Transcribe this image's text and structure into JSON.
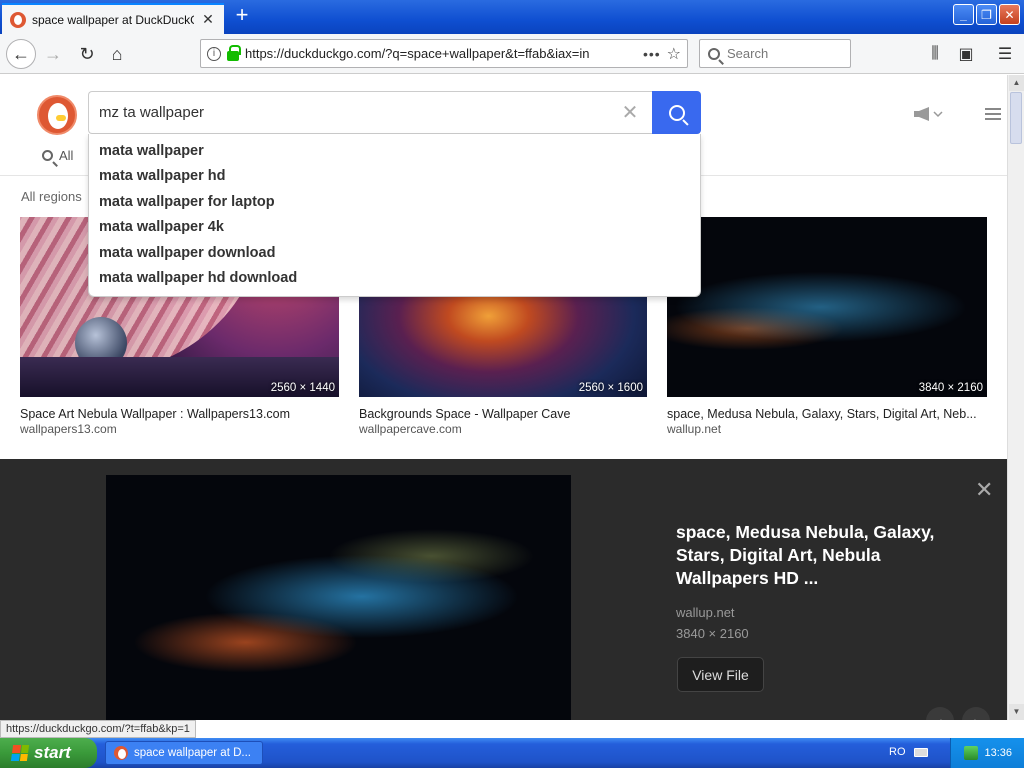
{
  "browser": {
    "tab_title": "space wallpaper at DuckDuckGo",
    "new_tab_label": "+",
    "url": "https://duckduckgo.com/?q=space+wallpaper&t=ffab&iax=in",
    "search_placeholder": "Search",
    "status_url": "https://duckduckgo.com/?t=ffab&kp=1"
  },
  "search": {
    "query": "mz ta wallpaper",
    "tab_all": "All",
    "region": "All regions",
    "suggestions": [
      "mata wallpaper",
      "mata wallpaper hd",
      "mata wallpaper for laptop",
      "mata wallpaper 4k",
      "mata wallpaper download",
      "mata wallpaper hd download"
    ]
  },
  "results": [
    {
      "title": "Space Art Nebula Wallpaper : Wallpapers13.com",
      "source": "wallpapers13.com",
      "dims": "2560 × 1440"
    },
    {
      "title": "Backgrounds Space - Wallpaper Cave",
      "source": "wallpapercave.com",
      "dims": "2560 × 1600"
    },
    {
      "title": "space, Medusa Nebula, Galaxy, Stars, Digital Art, Neb...",
      "source": "wallup.net",
      "dims": "3840 × 2160"
    }
  ],
  "detail": {
    "title": "space, Medusa Nebula, Galaxy, Stars, Digital Art, Nebula Wallpapers HD ...",
    "source": "wallup.net",
    "dims": "3840 × 2160",
    "view_file": "View File"
  },
  "taskbar": {
    "start": "start",
    "task_label": "space wallpaper at D...",
    "lang": "RO",
    "time": "13:36"
  },
  "colors": {
    "ddg_orange": "#de5833",
    "search_button": "#3969ef",
    "detail_bg": "#2b2b2b"
  }
}
